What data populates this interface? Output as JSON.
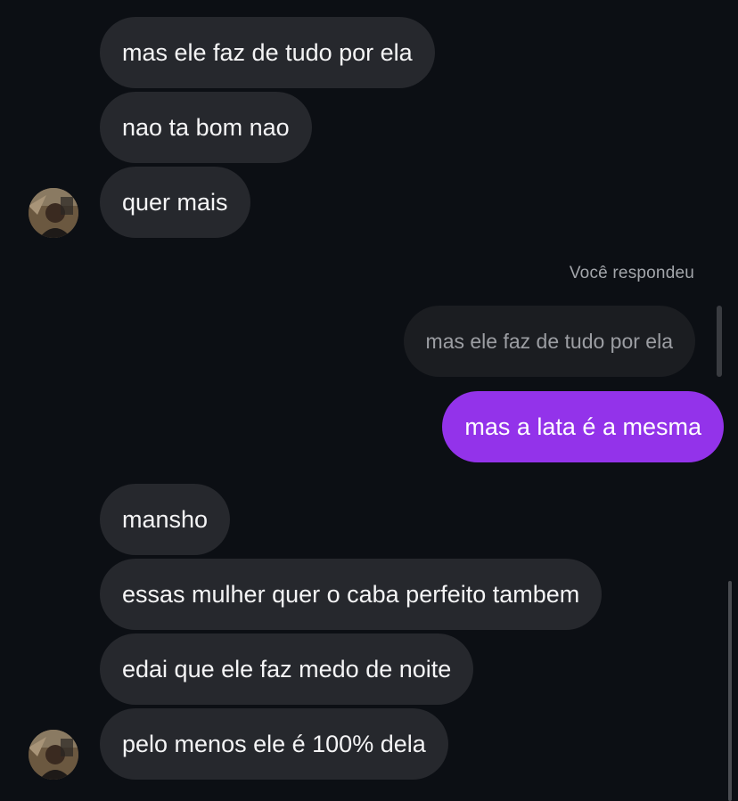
{
  "thread": {
    "incoming_group_1": [
      "mas ele faz de tudo por ela",
      "nao ta bom nao",
      "quer mais"
    ],
    "reply_label": "Você respondeu",
    "quoted_message": "mas ele faz de tudo por ela",
    "outgoing_message": "mas a lata é a mesma",
    "incoming_group_2": [
      "mansho",
      "essas mulher quer o caba perfeito tambem",
      "edai que ele faz medo de noite",
      "pelo menos ele é 100% dela"
    ]
  },
  "colors": {
    "background": "#0c0f14",
    "incoming_bubble": "#26282d",
    "quoted_bubble": "#1b1d21",
    "outgoing_bubble": "#9333ea"
  },
  "icons": {
    "avatar": "user-photo-avatar"
  }
}
